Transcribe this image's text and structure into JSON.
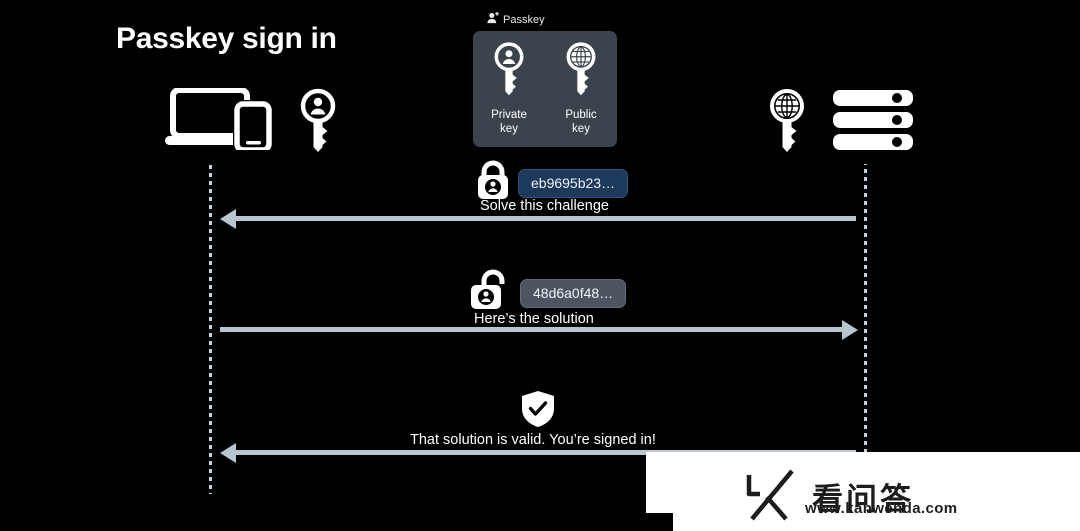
{
  "diagram": {
    "title": "Passkey sign in",
    "background_color": "#000000",
    "accent_arrow_color": "#b9c6d2",
    "passkey_box_color": "#3b444d"
  },
  "passkey": {
    "caption": "Passkey",
    "caption_icon": "person-add-icon",
    "private_key": {
      "icon": "private-key-icon",
      "label_line1": "Private",
      "label_line2": "key"
    },
    "public_key": {
      "icon": "public-key-icon",
      "label_line1": "Public",
      "label_line2": "key"
    }
  },
  "actors": {
    "client": {
      "devices_icon": "laptop-phone-icon",
      "key_icon": "private-key-icon"
    },
    "server": {
      "key_icon": "public-key-icon",
      "server_icon": "server-stack-icon"
    }
  },
  "messages": [
    {
      "id": "challenge",
      "icon": "locked-padlock-person-icon",
      "pill_value": "eb9695b23…",
      "pill_color": "#1d3a5c",
      "label": "Solve this challenge",
      "direction": "server-to-client"
    },
    {
      "id": "solution",
      "icon": "unlocked-padlock-person-icon",
      "pill_value": "48d6a0f48…",
      "pill_color": "#4c5560",
      "label": "Here’s the solution",
      "direction": "client-to-server"
    },
    {
      "id": "verified",
      "icon": "shield-check-icon",
      "pill_value": "",
      "label": "That solution is valid. You’re signed in!",
      "direction": "server-to-client"
    }
  ],
  "watermark": {
    "logo": "kanwenda-k-logo",
    "text_cn": "看问答",
    "url": "www.kanwenda.com"
  }
}
